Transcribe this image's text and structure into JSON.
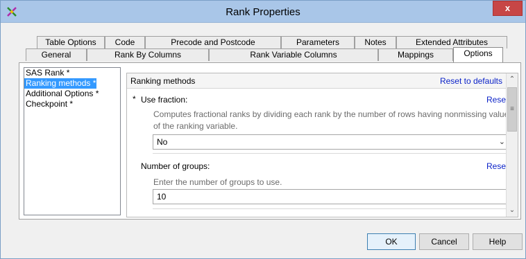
{
  "window": {
    "title": "Rank Properties",
    "close_glyph": "x",
    "app_icon": "rank-properties-icon"
  },
  "tabs_row1": [
    "Table Options",
    "Code",
    "Precode and Postcode",
    "Parameters",
    "Notes",
    "Extended Attributes"
  ],
  "tabs_row2": [
    "General",
    "Rank By Columns",
    "Rank Variable Columns",
    "Mappings",
    "Options"
  ],
  "active_tab": "Options",
  "nav": {
    "items": [
      "SAS Rank *",
      "Ranking methods *",
      "Additional Options *",
      "Checkpoint *"
    ],
    "selected": "Ranking methods *"
  },
  "panel": {
    "title": "Ranking methods",
    "reset_defaults": "Reset to defaults",
    "use_fraction": {
      "required_mark": "*",
      "label": "Use fraction:",
      "reset": "Reset",
      "description_line1": "Computes fractional ranks by dividing each rank by the number of rows having nonmissing values",
      "description_line2": "of the ranking variable.",
      "value": "No"
    },
    "groups": {
      "label": "Number of groups:",
      "reset": "Reset",
      "description": "Enter the number of groups to use.",
      "value": "10"
    }
  },
  "buttons": {
    "ok": "OK",
    "cancel": "Cancel",
    "help": "Help"
  },
  "colors": {
    "titlebar": "#a9c6e8",
    "close": "#c74646",
    "link": "#0b22c8",
    "selection": "#3399ff"
  }
}
